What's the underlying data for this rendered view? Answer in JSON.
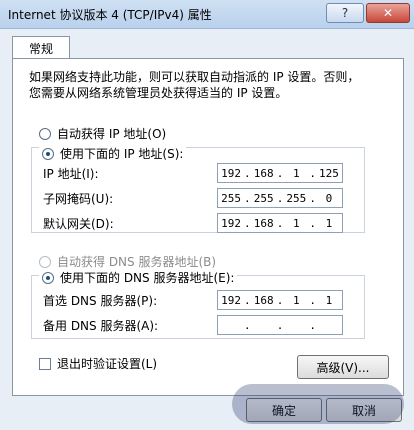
{
  "window": {
    "title": "Internet 协议版本 4 (TCP/IPv4) 属性",
    "help_label": "?",
    "close_label": "✕"
  },
  "tab": {
    "label": "常规"
  },
  "description": {
    "line1": "如果网络支持此功能，则可以获取自动指派的 IP 设置。否则，",
    "line2": "您需要从网络系统管理员处获得适当的 IP 设置。"
  },
  "ip": {
    "auto_label": "自动获得 IP 地址(O)",
    "manual_label": "使用下面的 IP 地址(S):",
    "selected": "manual",
    "address": {
      "label": "IP 地址(I):",
      "octets": [
        "192",
        "168",
        "1",
        "125"
      ]
    },
    "mask": {
      "label": "子网掩码(U):",
      "octets": [
        "255",
        "255",
        "255",
        "0"
      ]
    },
    "gateway": {
      "label": "默认网关(D):",
      "octets": [
        "192",
        "168",
        "1",
        "1"
      ]
    }
  },
  "dns": {
    "auto_label": "自动获得 DNS 服务器地址(B)",
    "manual_label": "使用下面的 DNS 服务器地址(E):",
    "selected": "manual",
    "preferred": {
      "label": "首选 DNS 服务器(P):",
      "octets": [
        "192",
        "168",
        "1",
        "1"
      ]
    },
    "alternate": {
      "label": "备用 DNS 服务器(A):",
      "octets": [
        "",
        "",
        "",
        ""
      ]
    }
  },
  "validate": {
    "label": "退出时验证设置(L)",
    "checked": false
  },
  "advanced_label": "高级(V)...",
  "ok_label": "确定",
  "cancel_label": "取消"
}
